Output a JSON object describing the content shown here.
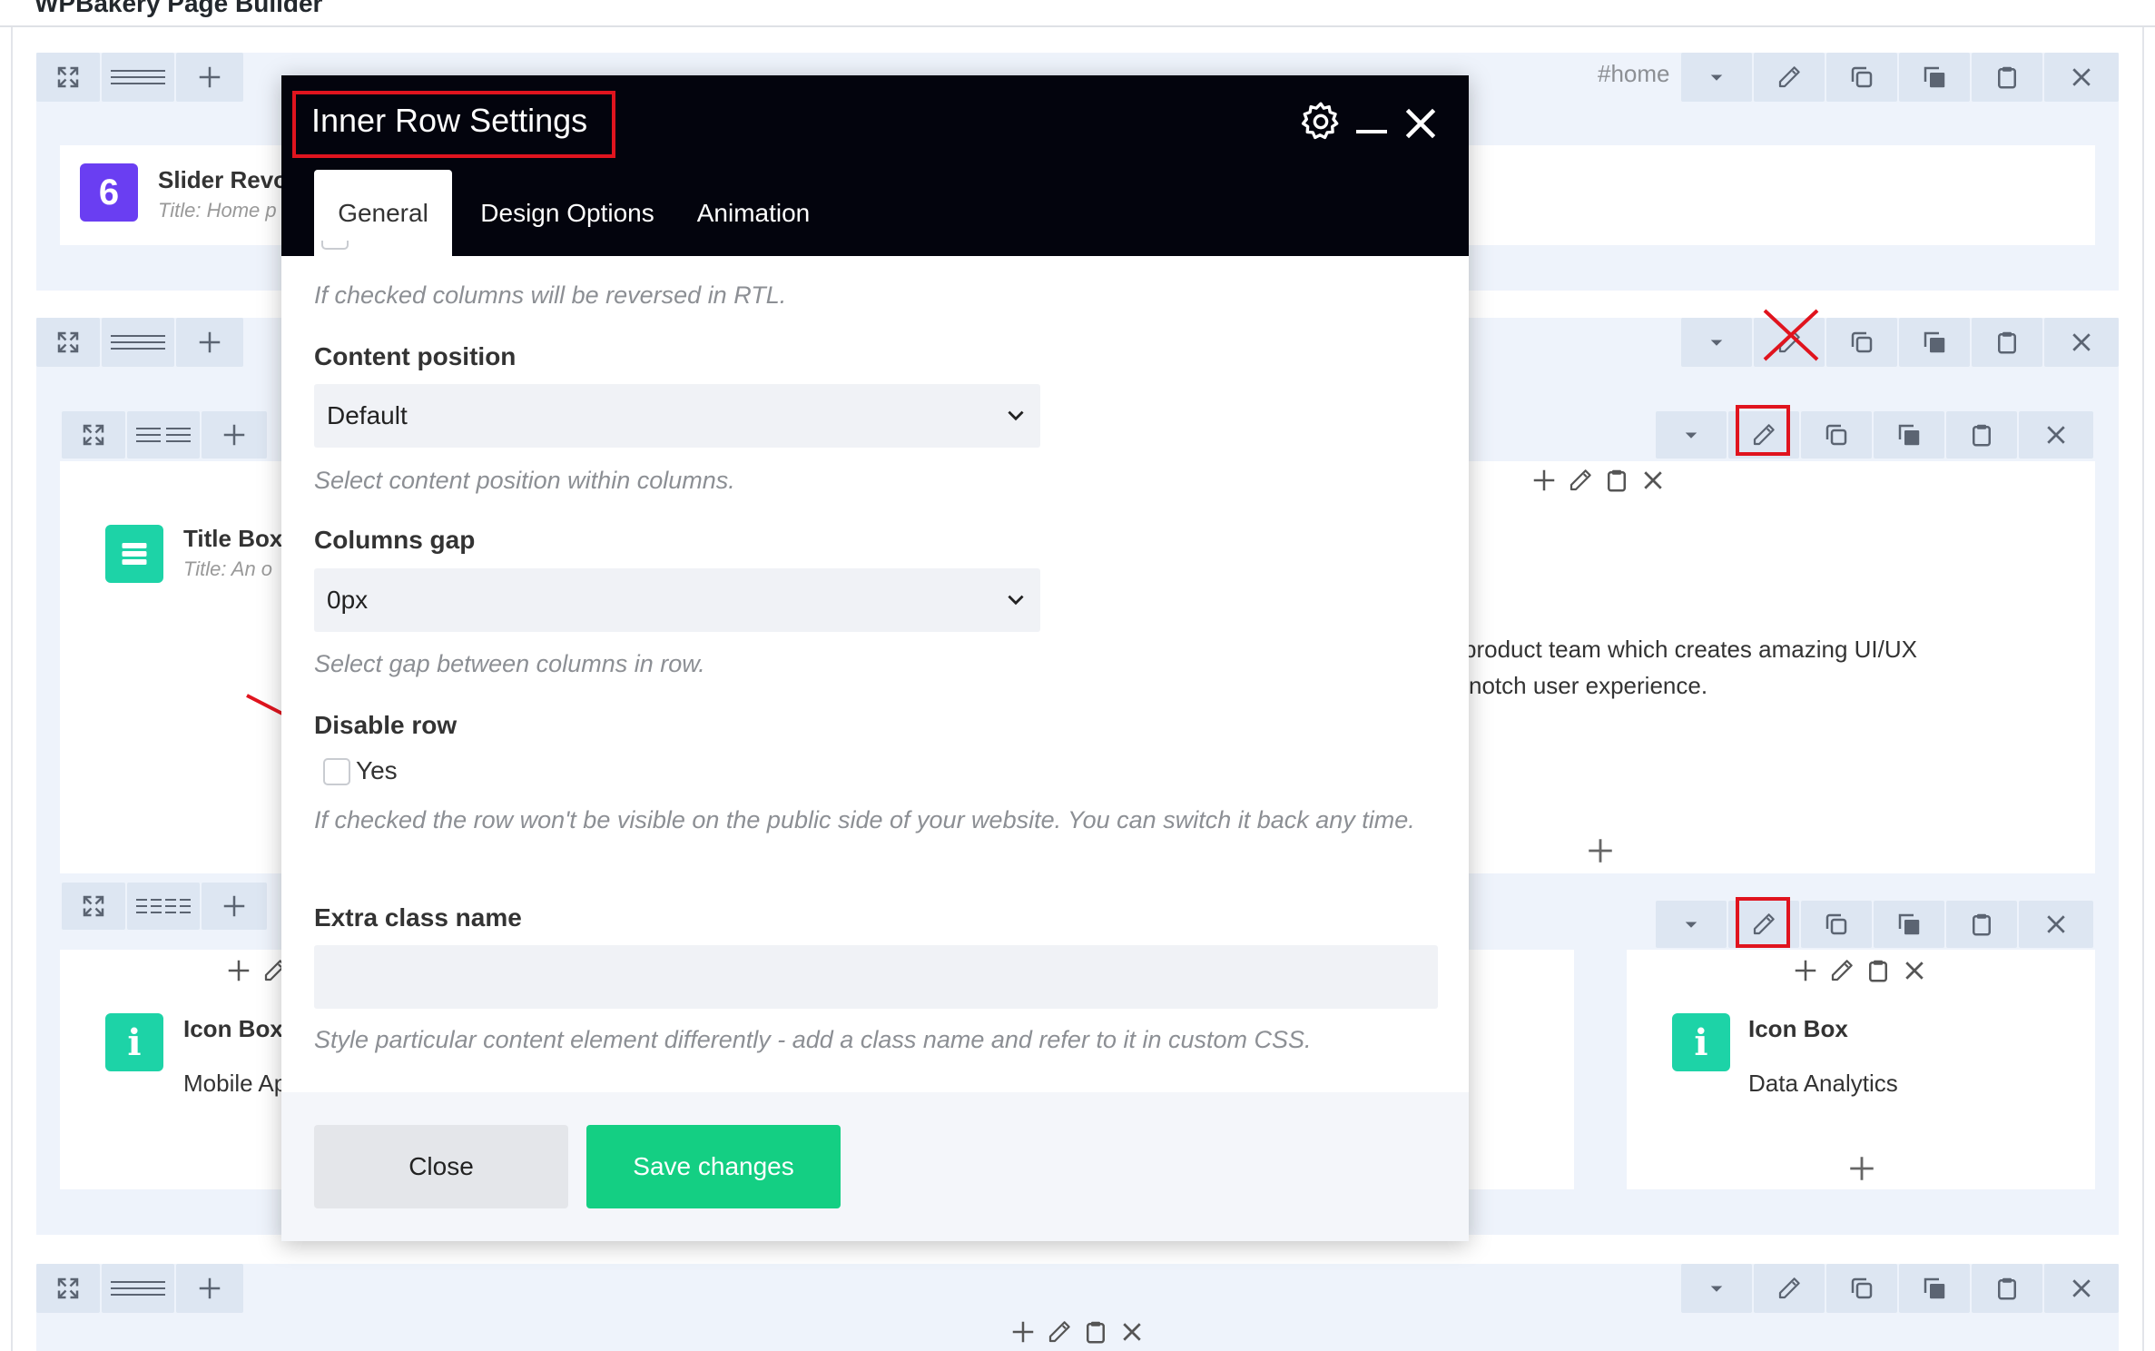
{
  "page": {
    "header_title": "WPBakery Page Builder",
    "anchor": "#home"
  },
  "rows": {
    "slider": {
      "title": "Slider Revo",
      "subtitle": "Title: Home p",
      "icon_text": "6"
    },
    "titlebox": {
      "title": "Title Box",
      "subtitle": "Title: An o"
    },
    "body_text": [
      "product team which creates amazing UI/UX",
      "notch user experience."
    ],
    "iconbox_left": {
      "title": "Icon Box",
      "value": "Mobile Ap"
    },
    "iconbox_right": {
      "title": "Icon Box",
      "value": "Data Analytics"
    }
  },
  "modal": {
    "title": "Inner Row Settings",
    "tabs": [
      {
        "label": "General",
        "active": true
      },
      {
        "label": "Design Options",
        "active": false
      },
      {
        "label": "Animation",
        "active": false
      }
    ],
    "rtl_help": "If checked columns will be reversed in RTL.",
    "content_position": {
      "label": "Content position",
      "value": "Default",
      "help": "Select content position within columns."
    },
    "columns_gap": {
      "label": "Columns gap",
      "value": "0px",
      "help": "Select gap between columns in row."
    },
    "disable_row": {
      "label": "Disable row",
      "option": "Yes",
      "checked": false,
      "help": "If checked the row won't be visible on the public side of your website. You can switch it back any time."
    },
    "extra_class": {
      "label": "Extra class name",
      "value": "",
      "help": "Style particular content element differently - add a class name and refer to it in custom CSS."
    },
    "buttons": {
      "close": "Close",
      "save": "Save changes"
    }
  },
  "colors": {
    "modal_header": "#03040d",
    "accent_save": "#14cf83",
    "annotation_red": "#e0141e",
    "row_background": "#eef3fb",
    "control_background": "#dde6f2"
  },
  "icons": [
    "expand-icon",
    "drag-handle-icon",
    "plus-icon",
    "dropdown-icon",
    "pencil-icon",
    "clone-icon",
    "copy-icon",
    "paste-icon",
    "delete-icon",
    "gear-icon",
    "minimize-icon",
    "close-icon",
    "chevron-down-icon"
  ]
}
